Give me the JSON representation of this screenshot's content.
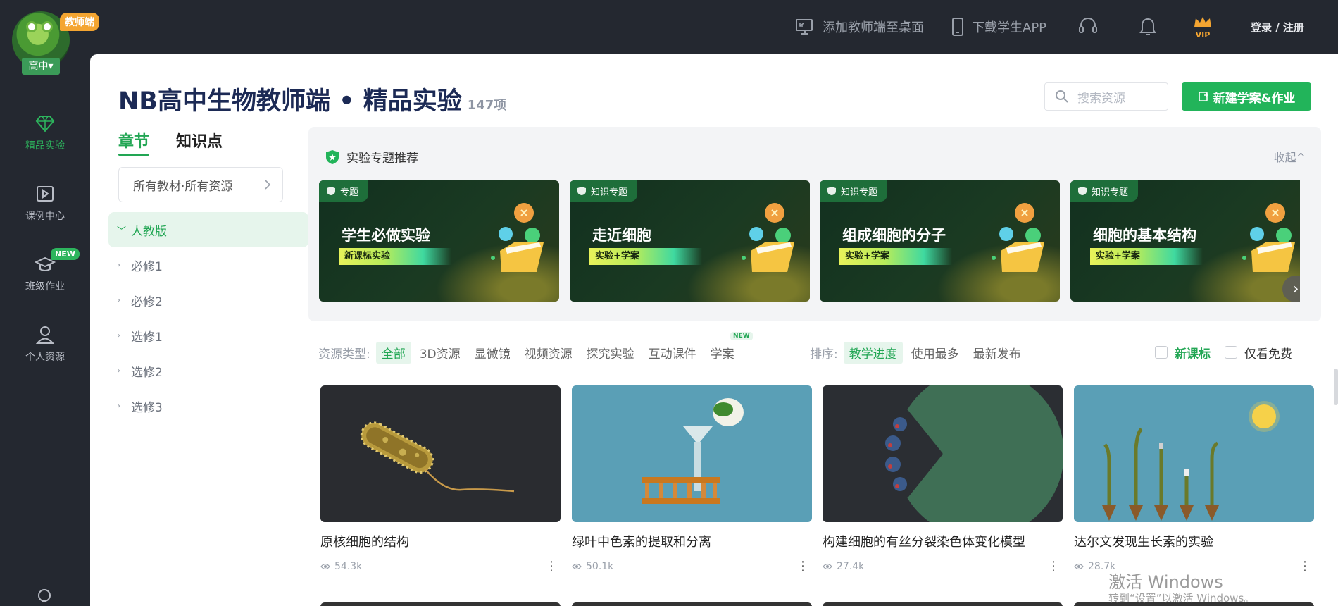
{
  "logo": {
    "tag": "教师端",
    "level": "高中▾"
  },
  "rail": {
    "items": [
      {
        "label": "精品实验",
        "icon": "diamond-icon"
      },
      {
        "label": "课例中心",
        "icon": "play-square-icon"
      },
      {
        "label": "班级作业",
        "icon": "graduation-cap-icon",
        "badge": "NEW"
      },
      {
        "label": "个人资源",
        "icon": "user-icon"
      }
    ]
  },
  "topbar": {
    "add_desktop": "添加教师端至桌面",
    "download_app": "下载学生APP",
    "vip": "VIP",
    "login": "登录 / 注册"
  },
  "header": {
    "title": "NB高中生物教师端 • 精品实验",
    "count": "147项",
    "search_placeholder": "搜索资源",
    "new_button": "新建学案&作业"
  },
  "sidebar": {
    "tabs": [
      "章节",
      "知识点"
    ],
    "filter": "所有教材·所有资源",
    "tree": [
      {
        "label": "人教版",
        "expanded": true
      },
      {
        "label": "必修1"
      },
      {
        "label": "必修2"
      },
      {
        "label": "选修1"
      },
      {
        "label": "选修2"
      },
      {
        "label": "选修3"
      }
    ]
  },
  "featured": {
    "heading": "实验专题推荐",
    "collapse": "收起^",
    "cards": [
      {
        "tag": "专题",
        "title": "学生必做实验",
        "sub": "新课标实验"
      },
      {
        "tag": "知识专题",
        "title": "走近细胞",
        "sub": "实验+学案"
      },
      {
        "tag": "知识专题",
        "title": "组成细胞的分子",
        "sub": "实验+学案"
      },
      {
        "tag": "知识专题",
        "title": "细胞的基本结构",
        "sub": "实验+学案"
      }
    ]
  },
  "filters": {
    "type_label": "资源类型:",
    "types": [
      "全部",
      "3D资源",
      "显微镜",
      "视频资源",
      "探究实验",
      "互动课件",
      "学案"
    ],
    "types_new": "NEW",
    "sort_label": "排序:",
    "sorts": [
      "教学进度",
      "使用最多",
      "最新发布"
    ],
    "check_new": "新课标",
    "check_free": "仅看免费"
  },
  "resources": [
    {
      "title": "原核细胞的结构",
      "views": "54.3k"
    },
    {
      "title": "绿叶中色素的提取和分离",
      "views": "50.1k"
    },
    {
      "title": "构建细胞的有丝分裂染色体变化模型",
      "views": "27.4k"
    },
    {
      "title": "达尔文发现生长素的实验",
      "views": "28.7k"
    }
  ],
  "watermark": {
    "title": "激活 Windows",
    "sub": "转到“设置”以激活 Windows。"
  },
  "colors": {
    "accent": "#22b45a",
    "title": "#1c2a55",
    "rail": "#242830"
  }
}
